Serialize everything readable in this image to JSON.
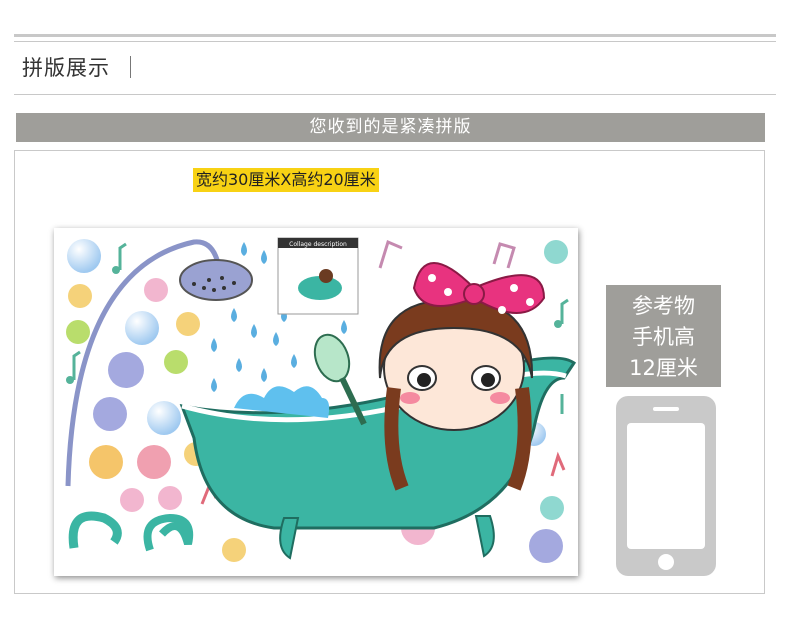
{
  "header": {
    "title": "拼版展示"
  },
  "banner": {
    "text": "您收到的是紧凑拼版"
  },
  "product": {
    "size_label": "宽约30厘米X高约20厘米",
    "inset_caption": "Collage description"
  },
  "reference": {
    "line1": "参考物",
    "line2": "手机高",
    "line3": "12厘米"
  },
  "icons": {
    "phone": "phone-icon"
  },
  "colors": {
    "banner": "#9f9e9a",
    "highlight": "#f8d214",
    "tub": "#3bb5a3",
    "bow": "#e8337f"
  }
}
